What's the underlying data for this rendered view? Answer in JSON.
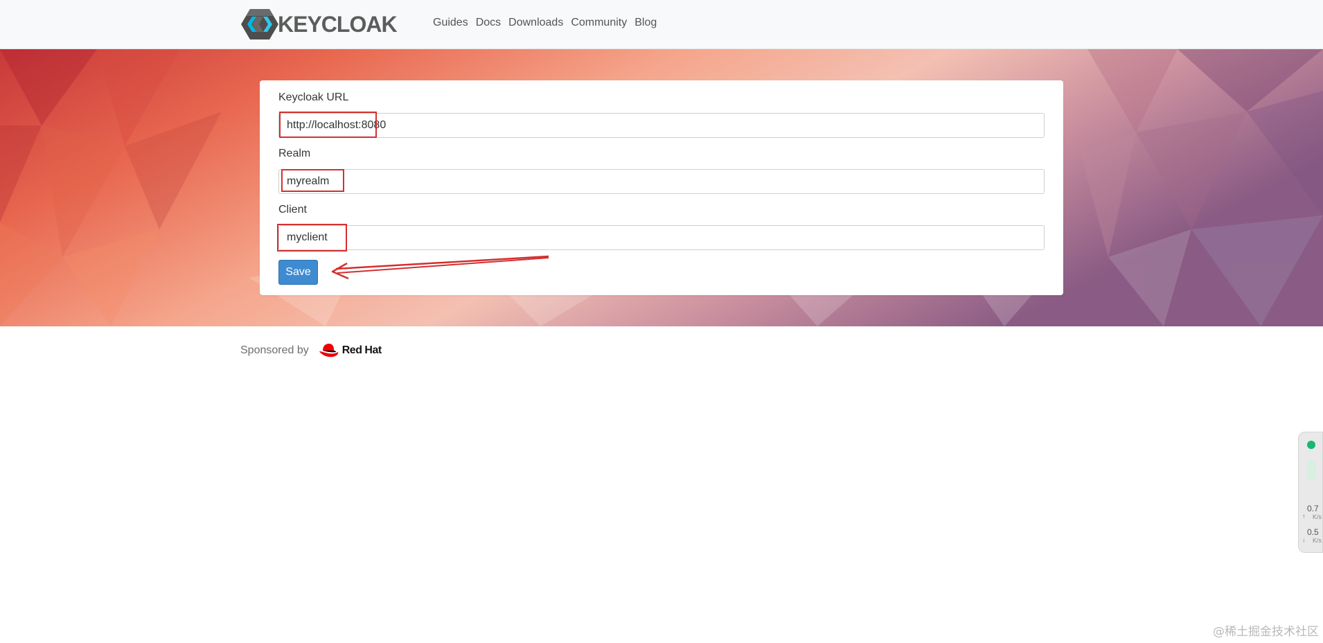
{
  "navbar": {
    "logo_text": "KEYCLOAK",
    "links": [
      "Guides",
      "Docs",
      "Downloads",
      "Community",
      "Blog"
    ]
  },
  "form": {
    "url_label": "Keycloak URL",
    "url_value": "http://localhost:8080",
    "realm_label": "Realm",
    "realm_value": "myrealm",
    "client_label": "Client",
    "client_value": "myclient",
    "save_label": "Save"
  },
  "footer": {
    "sponsored_label": "Sponsored by",
    "sponsor_name": "Red Hat"
  },
  "widget": {
    "upload_value": "0.7",
    "upload_unit": "K/s",
    "download_value": "0.5",
    "download_unit": "K/s"
  },
  "watermark": "@稀土掘金技术社区",
  "colors": {
    "primary_button": "#3f8bd1",
    "annotation_red": "#d32f2f",
    "logo_blue": "#1ea5d8"
  }
}
